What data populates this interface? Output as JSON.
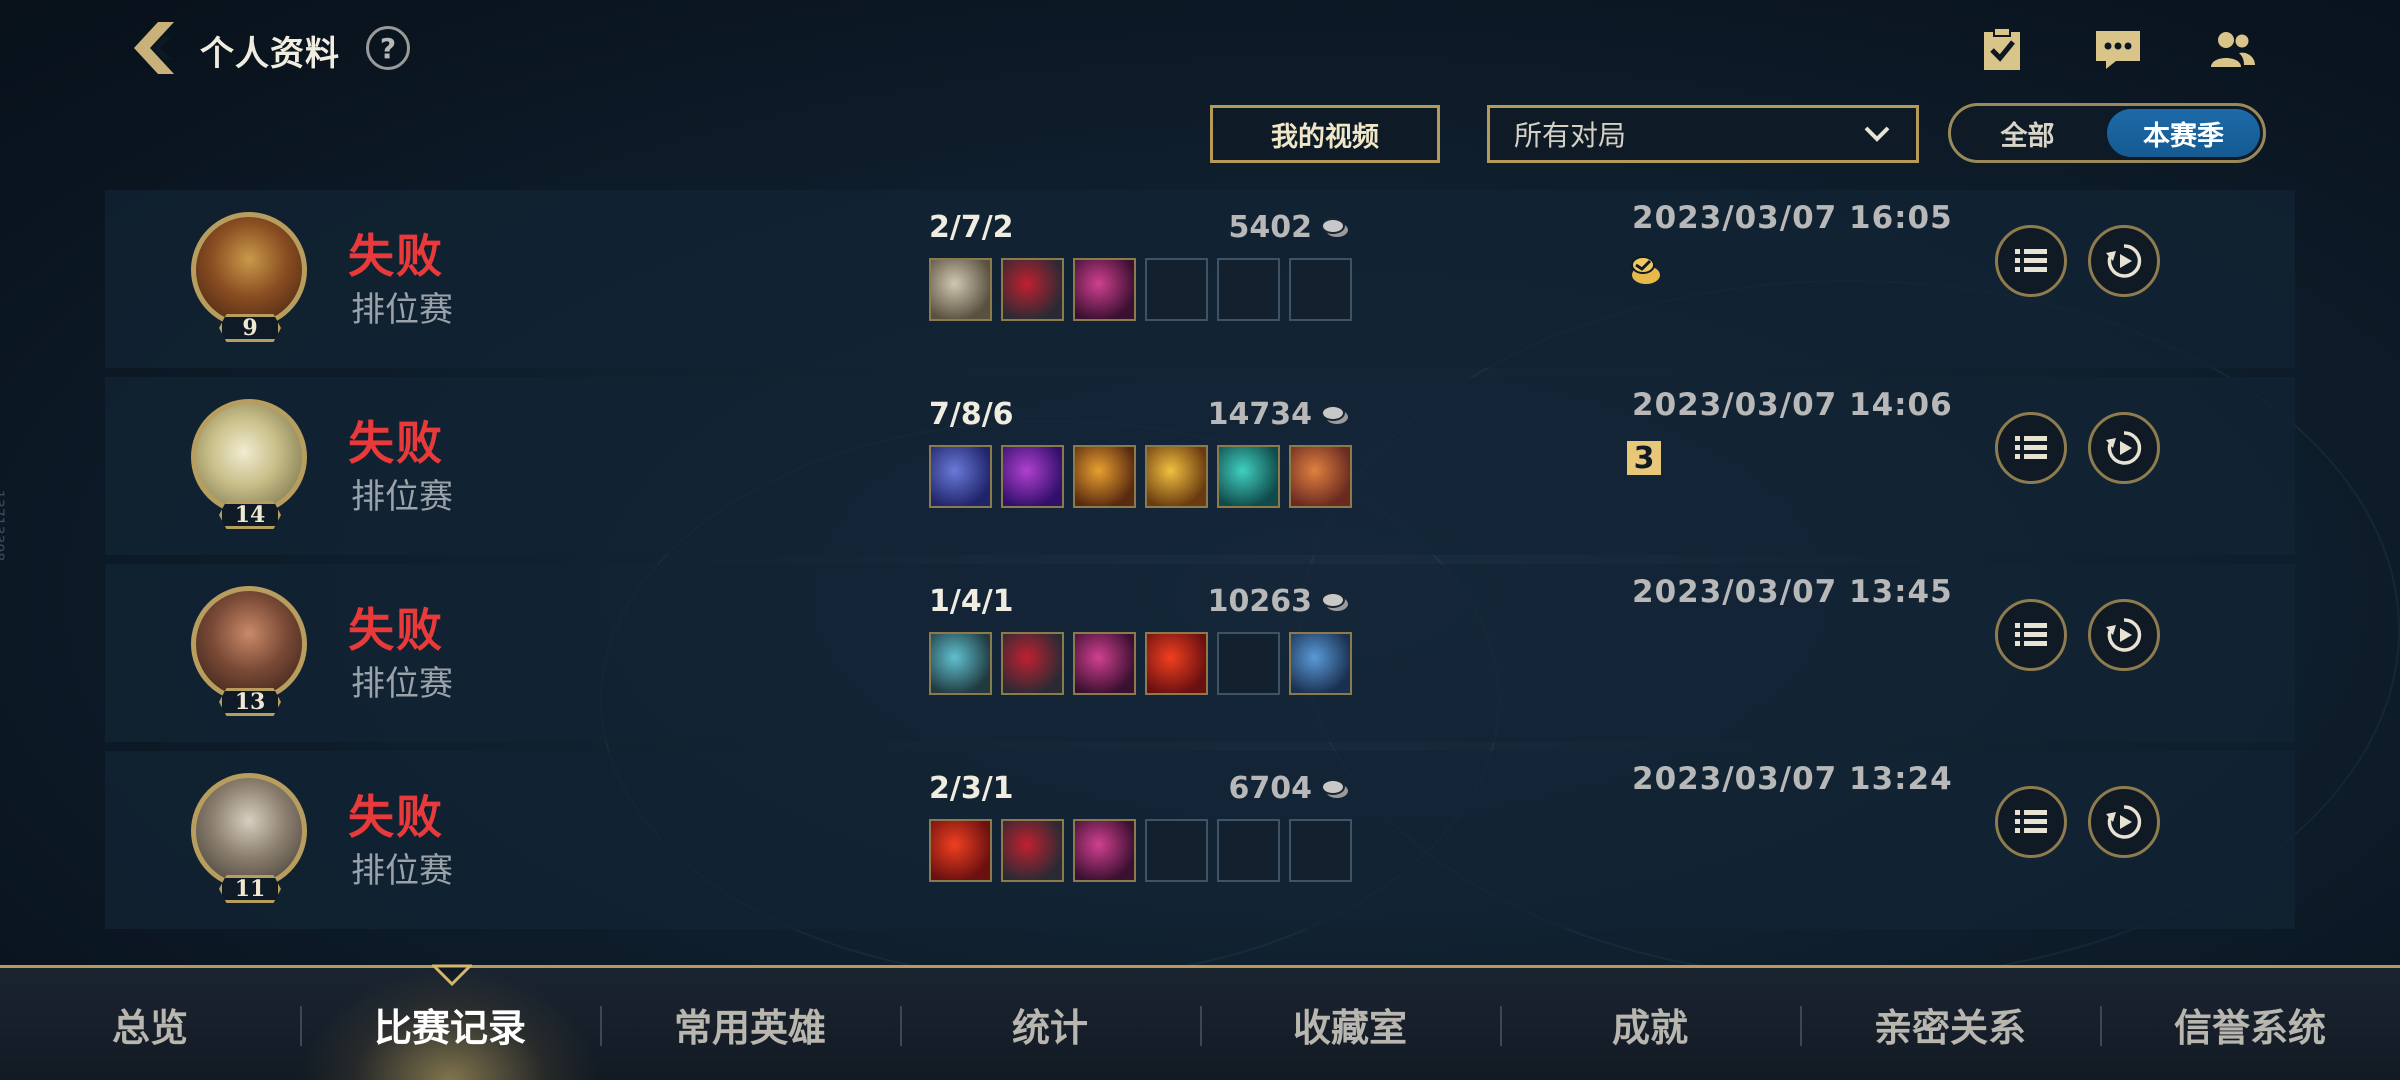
{
  "header": {
    "title": "个人资料",
    "help": "?"
  },
  "controls": {
    "video_button": "我的视频",
    "filter_selected": "所有对局",
    "season_all": "全部",
    "season_current": "本赛季"
  },
  "matches": [
    {
      "level": "9",
      "result": "失败",
      "mode": "排位赛",
      "kda": "2/7/2",
      "gold": "5402",
      "date": "2023/03/07 16:05",
      "items": [
        "sword-item-icon",
        "gauntlet-item-icon",
        "pink-gauntlet-item-icon",
        "",
        "",
        ""
      ],
      "extra_badge": "ward-badge-icon"
    },
    {
      "level": "14",
      "result": "失败",
      "mode": "排位赛",
      "kda": "7/8/6",
      "gold": "14734",
      "date": "2023/03/07 14:06",
      "items": [
        "spear-item-icon",
        "purple-orb-item-icon",
        "gold-helm-item-icon",
        "scroll-item-icon",
        "teal-cloak-item-icon",
        "mask-item-icon"
      ],
      "extra_badge": "triple-kill-badge-icon",
      "extra_badge_text": "3"
    },
    {
      "level": "13",
      "result": "失败",
      "mode": "排位赛",
      "kda": "1/4/1",
      "gold": "10263",
      "date": "2023/03/07 13:45",
      "items": [
        "hammer-item-icon",
        "gauntlet-item-icon",
        "pink-gauntlet-item-icon",
        "red-orb-item-icon",
        "",
        "boots-item-icon"
      ]
    },
    {
      "level": "11",
      "result": "失败",
      "mode": "排位赛",
      "kda": "2/3/1",
      "gold": "6704",
      "date": "2023/03/07 13:24",
      "items": [
        "red-orb-item-icon",
        "gauntlet-item-icon",
        "pink-gauntlet-item-icon",
        "",
        "",
        ""
      ]
    }
  ],
  "bottom_nav": [
    "总览",
    "比赛记录",
    "常用英雄",
    "统计",
    "收藏室",
    "成就",
    "亲密关系",
    "信誉系统"
  ],
  "active_tab": "比赛记录",
  "side_id": "13713398",
  "colors": {
    "loss_red": "#e83a3a",
    "gold_border": "#b59a58",
    "active_blue": "#1d6aa8"
  }
}
